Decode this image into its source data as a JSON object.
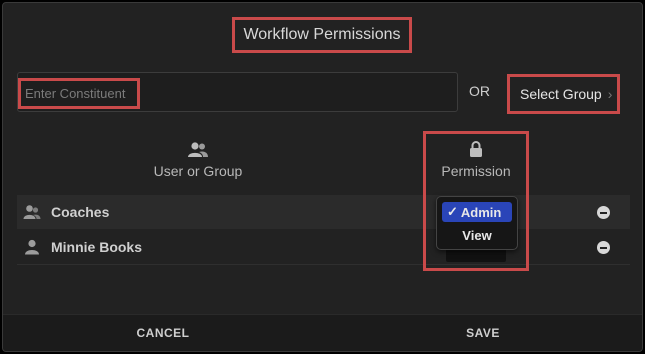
{
  "dialog": {
    "title": "Workflow Permissions",
    "constituent_input": {
      "placeholder": "Enter Constituent",
      "value": ""
    },
    "or_label": "OR",
    "select_group_label": "Select Group",
    "columns": {
      "user_or_group": "User or Group",
      "permission": "Permission"
    },
    "rows": [
      {
        "name": "Coaches",
        "type": "group"
      },
      {
        "name": "Minnie Books",
        "type": "user"
      }
    ],
    "permission_menu": {
      "options": [
        {
          "label": "Admin",
          "selected": true,
          "check": "✓"
        },
        {
          "label": "View",
          "selected": false
        }
      ]
    },
    "footer": {
      "cancel": "CANCEL",
      "save": "SAVE"
    }
  },
  "colors": {
    "accent": "#2a45b8",
    "highlight": "#c94a4a",
    "background": "#222222"
  }
}
